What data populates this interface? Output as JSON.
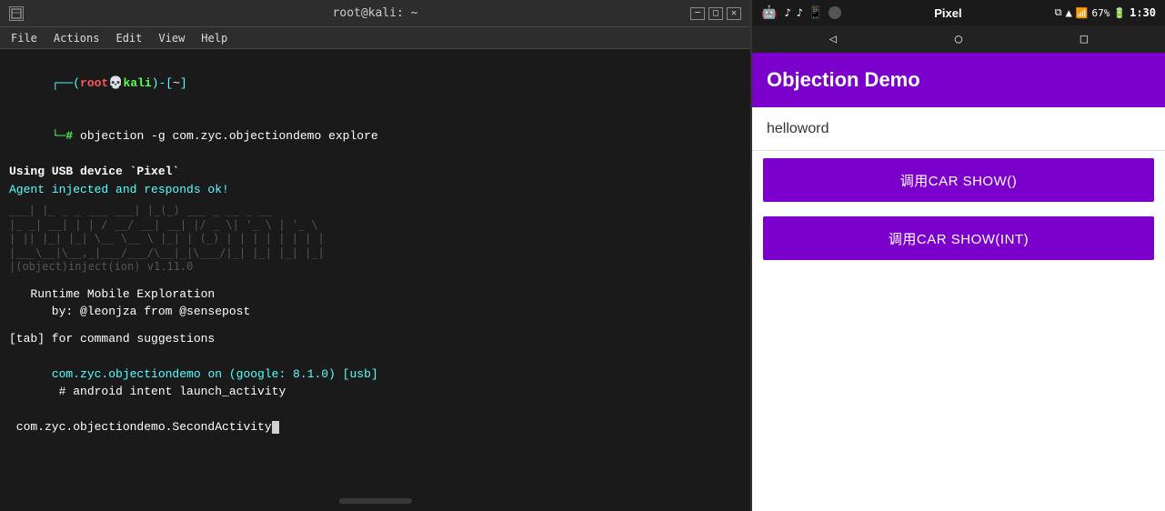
{
  "terminal": {
    "title": "root@kali: ~",
    "menubar": [
      "File",
      "Actions",
      "Edit",
      "View",
      "Help"
    ],
    "lines": [
      {
        "type": "prompt_cmd",
        "prompt": "(root💀kali)-[~]",
        "cmd": "objection -g com.zyc.objectiondemo explore"
      },
      {
        "type": "text",
        "text": "Using USB device `Pixel`",
        "color": "white",
        "bold": true
      },
      {
        "type": "text",
        "text": "Agent injected and responds ok!",
        "color": "cyan"
      },
      {
        "type": "ascii",
        "lines": [
          " ___| |_ _   _ ___ ___| |_(_) ___  _ __ ",
          "|_ _| __| | | / __/ __| __| |/ _ \\| '_ \\",
          " | || |_| |_| \\__ \\__ \\ |_| | (_) | | | |",
          "|___\\__|\\__,_|___/___/\\__|_|\\___/|_| |_|",
          "     |(object)inject(ion) v1.11.0"
        ]
      },
      {
        "type": "text",
        "text": "   Runtime Mobile Exploration",
        "color": "white"
      },
      {
        "type": "text",
        "text": "      by: @leonjza from @sensepost",
        "color": "white"
      },
      {
        "type": "blank"
      },
      {
        "type": "text",
        "text": "[tab] for command suggestions",
        "color": "white"
      },
      {
        "type": "prompt_shell",
        "shell": "com.zyc.objectiondemo on (google: 8.1.0) [usb]",
        "cmd": "android intent launch_activity"
      },
      {
        "type": "text",
        "text": " com.zyc.objectiondemo.SecondActivity",
        "color": "white",
        "cursor": true
      }
    ]
  },
  "phone": {
    "statusbar": {
      "device_name": "Pixel",
      "battery": "67%",
      "time": "1:30"
    },
    "app_title": "Objection Demo",
    "text_field_value": "helloword",
    "buttons": [
      {
        "label": "调用CAR SHOW()"
      },
      {
        "label": "调用CAR SHOW(INT)"
      }
    ]
  }
}
